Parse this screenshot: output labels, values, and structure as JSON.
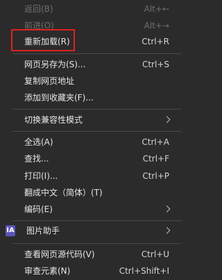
{
  "menu": {
    "back": {
      "label": "返回(B)",
      "shortcut": "Alt+←"
    },
    "forward": {
      "label": "前进(O)",
      "shortcut": "Alt+→"
    },
    "reload": {
      "label": "重新加载(R)",
      "shortcut": "Ctrl+R"
    },
    "save_as": {
      "label": "网页另存为(S)...",
      "shortcut": "Ctrl+S"
    },
    "copy_url": {
      "label": "复制网页地址"
    },
    "add_fav": {
      "label": "添加到收藏夹(F)..."
    },
    "compat": {
      "label": "切换兼容性模式"
    },
    "select_all": {
      "label": "全选(A)",
      "shortcut": "Ctrl+A"
    },
    "find": {
      "label": "查找...",
      "shortcut": "Ctrl+F"
    },
    "print": {
      "label": "打印(I)...",
      "shortcut": "Ctrl+P"
    },
    "translate": {
      "label": "翻成中文（简体）(T)"
    },
    "encoding": {
      "label": "编码(E)"
    },
    "image_helper": {
      "label": "图片助手",
      "icon_text": "IA",
      "icon": "ia-icon"
    },
    "view_source": {
      "label": "查看网页源代码(V)",
      "shortcut": "Ctrl+U"
    },
    "inspect": {
      "label": "审查元素(N)",
      "shortcut": "Ctrl+Shift+I"
    }
  }
}
